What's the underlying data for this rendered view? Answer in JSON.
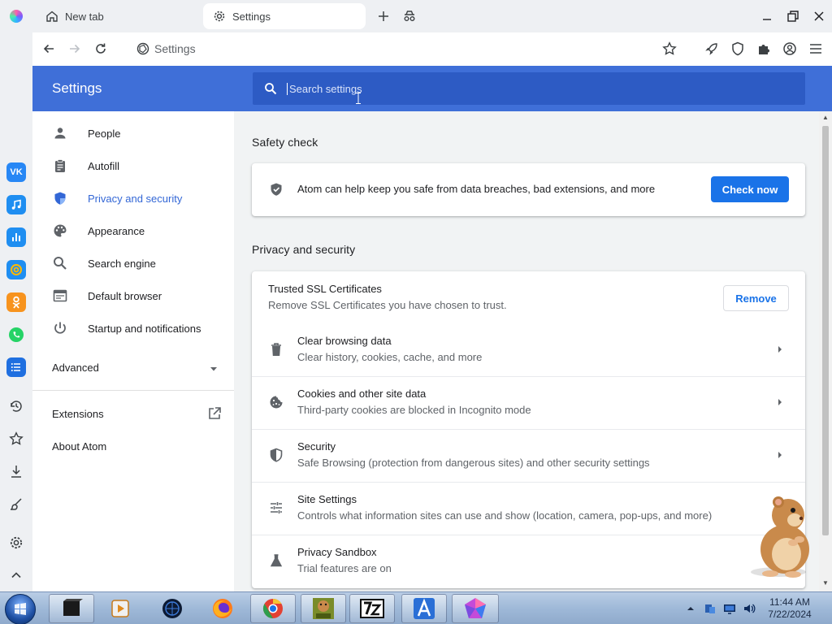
{
  "tabs": {
    "newtab_label": "New tab",
    "settings_label": "Settings"
  },
  "toolbar": {
    "address": "Settings"
  },
  "header": {
    "title": "Settings",
    "search_placeholder": "Search settings"
  },
  "nav": {
    "items": [
      {
        "label": "People",
        "icon": "person-icon"
      },
      {
        "label": "Autofill",
        "icon": "clipboard-icon"
      },
      {
        "label": "Privacy and security",
        "icon": "shield-icon"
      },
      {
        "label": "Appearance",
        "icon": "palette-icon"
      },
      {
        "label": "Search engine",
        "icon": "search-icon"
      },
      {
        "label": "Default browser",
        "icon": "browser-icon"
      },
      {
        "label": "Startup and notifications",
        "icon": "power-icon"
      }
    ],
    "advanced_label": "Advanced",
    "extensions_label": "Extensions",
    "about_label": "About Atom"
  },
  "safety_check": {
    "title": "Safety check",
    "text": "Atom can help keep you safe from data breaches, bad extensions, and more",
    "button": "Check now"
  },
  "privacy": {
    "title": "Privacy and security",
    "ssl": {
      "title": "Trusted SSL Certificates",
      "subtitle": "Remove SSL Certificates you have chosen to trust.",
      "button": "Remove"
    },
    "rows": [
      {
        "title": "Clear browsing data",
        "subtitle": "Clear history, cookies, cache, and more",
        "icon": "trash-icon"
      },
      {
        "title": "Cookies and other site data",
        "subtitle": "Third-party cookies are blocked in Incognito mode",
        "icon": "cookie-icon"
      },
      {
        "title": "Security",
        "subtitle": "Safe Browsing (protection from dangerous sites) and other security settings",
        "icon": "shield-icon"
      },
      {
        "title": "Site Settings",
        "subtitle": "Controls what information sites can use and show (location, camera, pop-ups, and more)",
        "icon": "sliders-icon"
      },
      {
        "title": "Privacy Sandbox",
        "subtitle": "Trial features are on",
        "icon": "flask-icon"
      }
    ]
  },
  "taskbar": {
    "clock_time": "11:44 AM",
    "clock_date": "7/22/2024",
    "apps": [
      "terminal-icon",
      "media-player-icon",
      "globe-icon",
      "firefox-icon",
      "chrome-like-icon",
      "box-game-icon",
      "7zip-icon",
      "atom-a-icon",
      "atom-gem-icon"
    ]
  },
  "colors": {
    "header_blue": "#3f6fd8",
    "search_blue": "#2d5bc4",
    "accent": "#1a73e8",
    "active_nav": "#3367d6"
  }
}
